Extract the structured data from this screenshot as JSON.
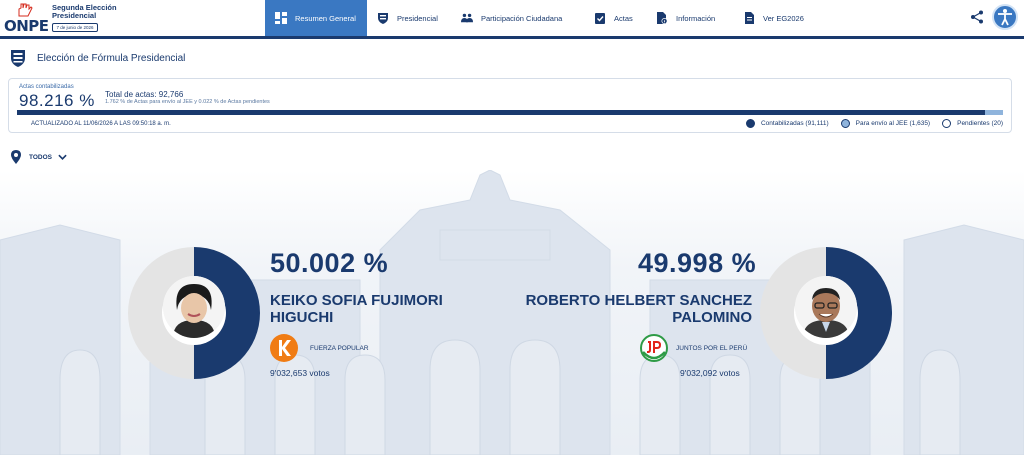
{
  "header": {
    "logo_text": "ONPE",
    "election_title": "Segunda Elección Presidencial",
    "election_date": "7 de junio de 2026",
    "tabs": [
      {
        "label": "Resumen General",
        "icon": "dashboard-icon",
        "active": true
      },
      {
        "label": "Presidencial",
        "icon": "peru-shield-icon",
        "active": false
      },
      {
        "label": "Participación Ciudadana",
        "icon": "people-icon",
        "active": false
      },
      {
        "label": "Actas",
        "icon": "clipboard-check-icon",
        "active": false
      },
      {
        "label": "Información",
        "icon": "info-document-icon",
        "active": false
      },
      {
        "label": "Ver EG2026",
        "icon": "document-icon",
        "active": false
      }
    ],
    "share_icon": "share-icon",
    "accessibility_icon": "accessibility-icon"
  },
  "section": {
    "title": "Elección de Fórmula Presidencial",
    "icon": "peru-shield-icon"
  },
  "progress": {
    "actas_label": "Actas contabilizadas",
    "actas_pct": "98.216 %",
    "total_actas": "Total de actas: 92,766",
    "note": "1.762 % de Actas para envío al JEE y 0.022 % de Actas pendientes",
    "updated": "ACTUALIZADO AL 11/06/2026 A LAS 09:50:18 a. m.",
    "contabilizadas_fraction": 0.98216,
    "jee_fraction": 0.01762,
    "pendientes_fraction": 0.00022,
    "legend": [
      {
        "label": "Contabilizadas (91,111)",
        "color": "#1a3a6e"
      },
      {
        "label": "Para envío al JEE (1,635)",
        "color": "#8fb4dc"
      },
      {
        "label": "Pendientes (20)",
        "color": "#ffffff"
      }
    ]
  },
  "filter": {
    "label": "TODOS",
    "icon": "location-pin-icon"
  },
  "candidates": [
    {
      "pct": "50.002 %",
      "share": 0.50002,
      "name_line1": "KEIKO SOFIA FUJIMORI",
      "name_line2": "HIGUCHI",
      "party": "FUERZA POPULAR",
      "votes": "9'032,653 votos",
      "party_color": "#f07c14"
    },
    {
      "pct": "49.998 %",
      "share": 0.49998,
      "name_line1": "ROBERTO HELBERT SANCHEZ",
      "name_line2": "PALOMINO",
      "party": "JUNTOS POR EL PERÚ",
      "votes": "9'032,092 votos",
      "party_color": "#2e9b46"
    }
  ],
  "colors": {
    "primary": "#1a3a6e",
    "accent": "#3a78c2",
    "donut_empty": "#e4e4e4"
  }
}
